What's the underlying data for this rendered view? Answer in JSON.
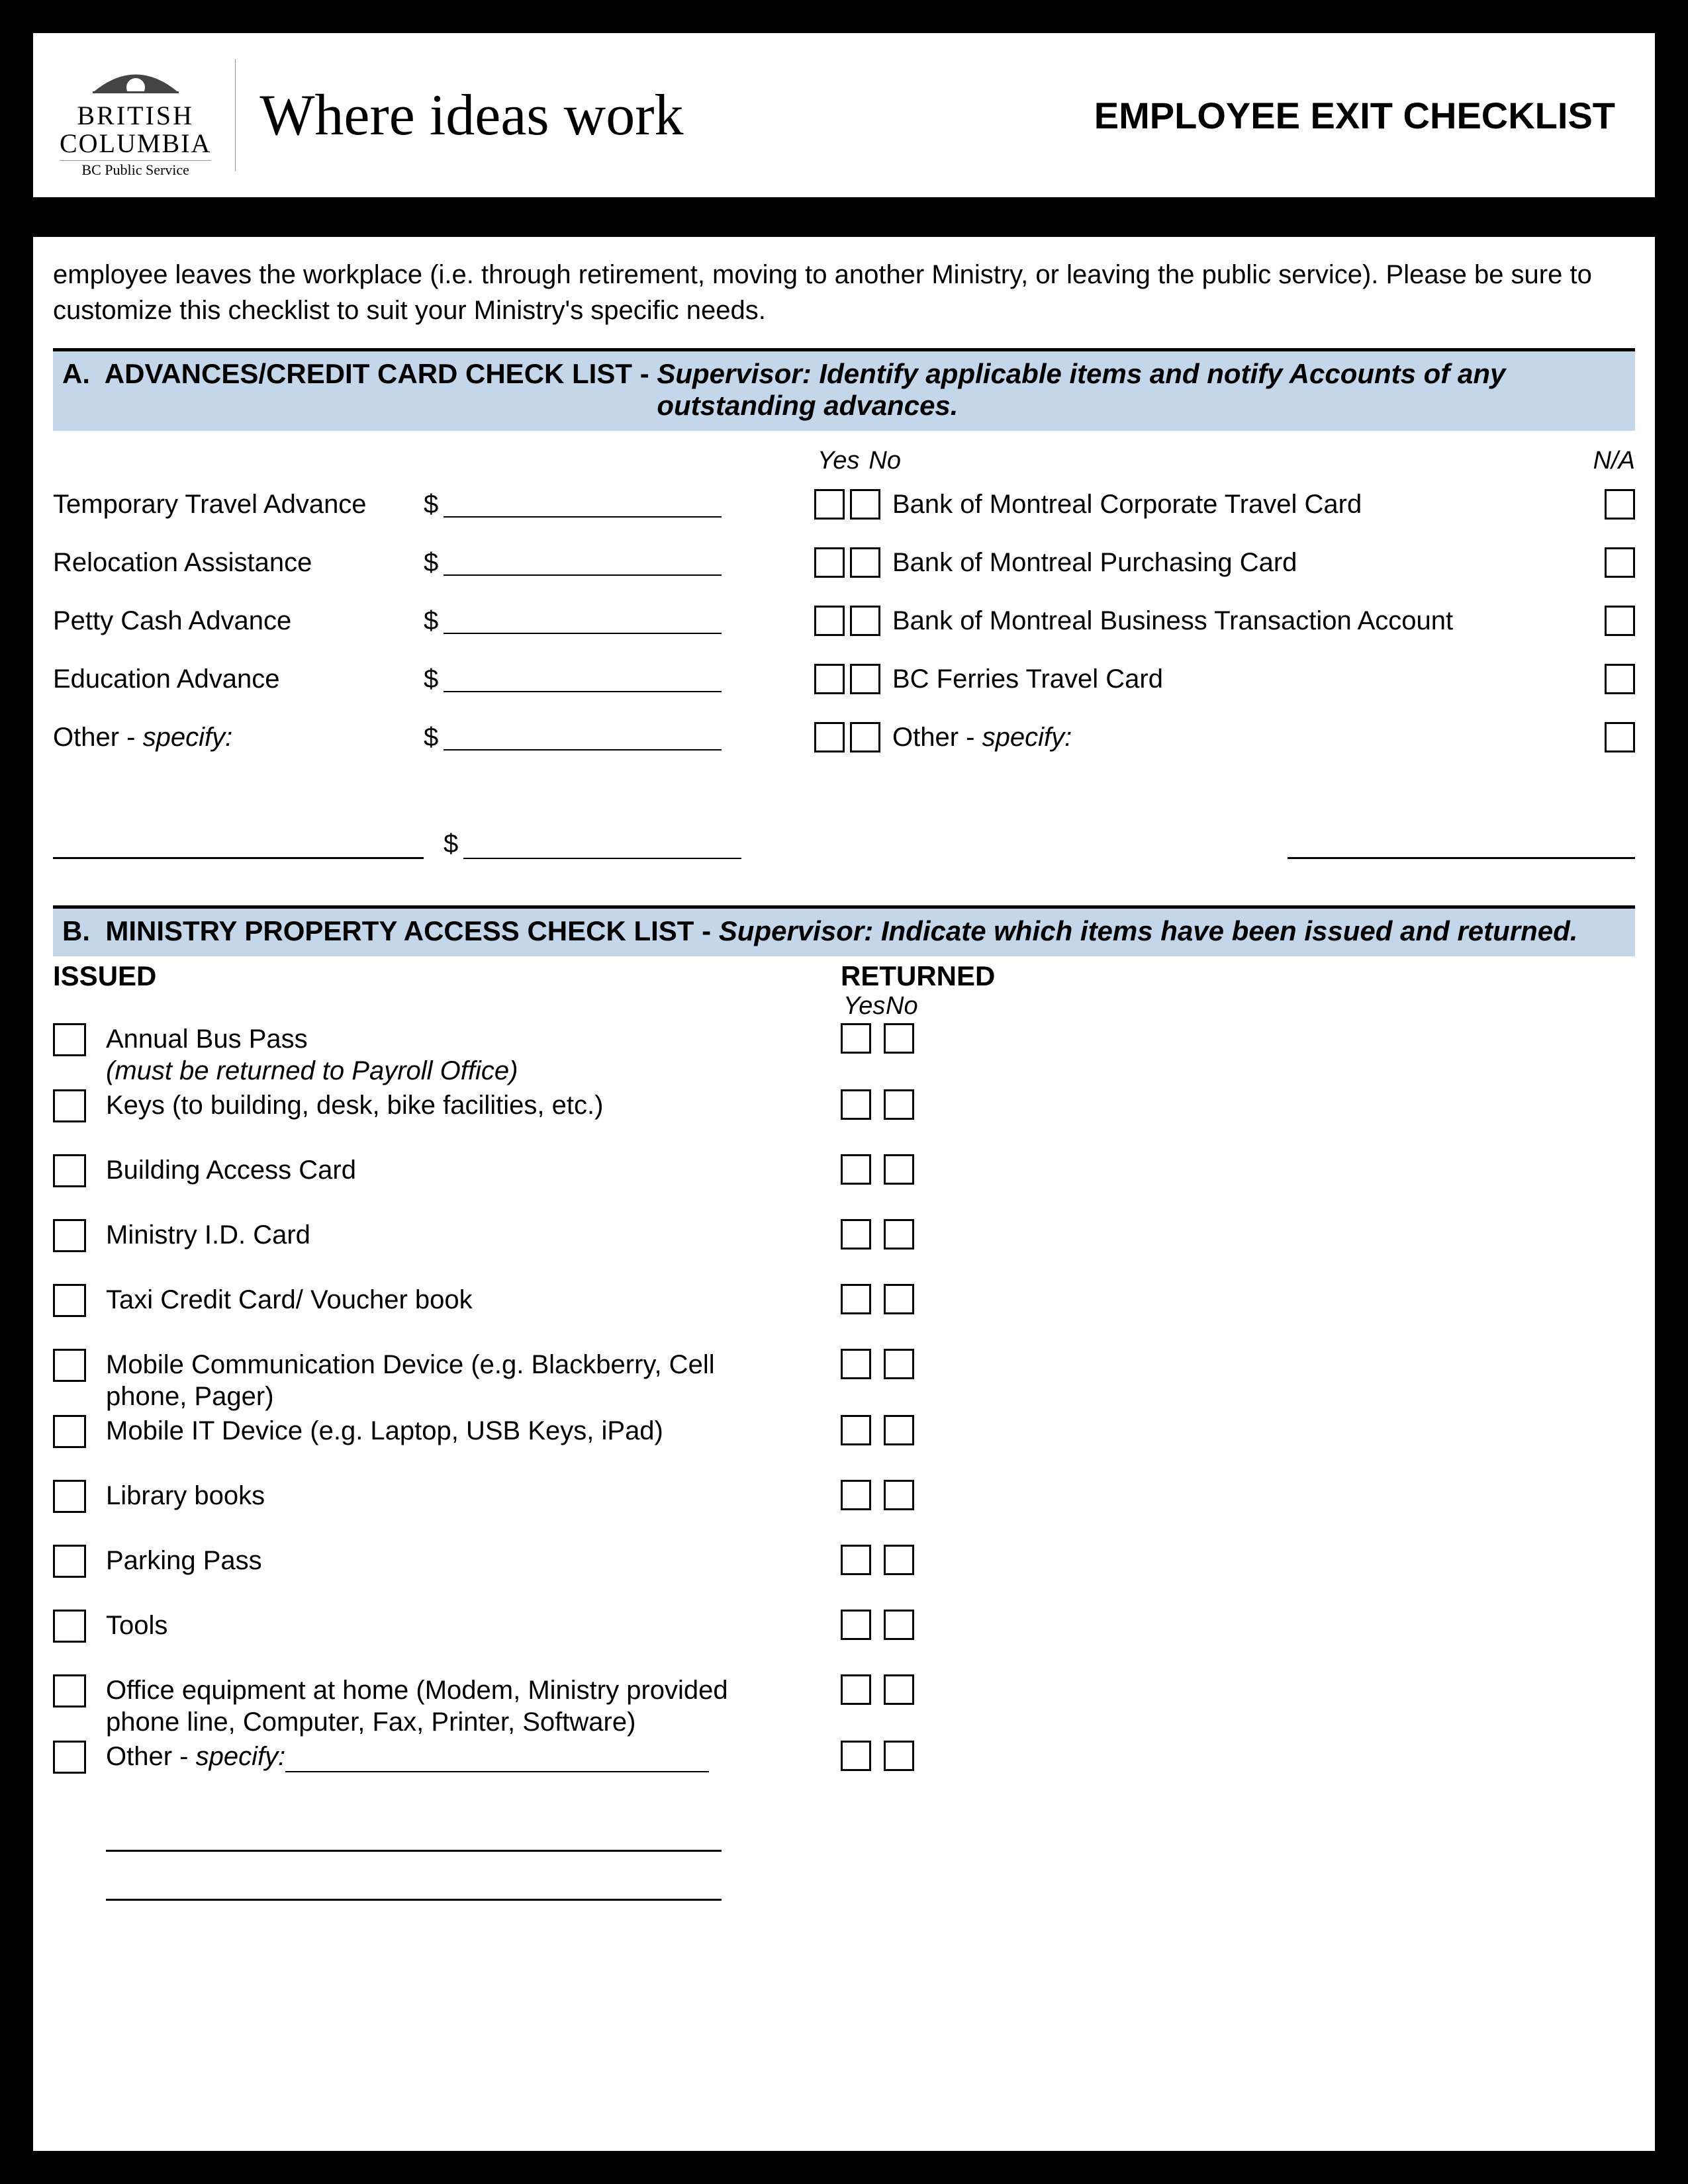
{
  "header": {
    "logo": {
      "line1": "BRITISH",
      "line2": "COLUMBIA",
      "line3": "BC Public Service"
    },
    "slogan": "Where ideas work",
    "title": "EMPLOYEE EXIT CHECKLIST"
  },
  "intro": "employee leaves the workplace (i.e. through retirement, moving to another Ministry, or leaving the public service).  Please be sure to customize this checklist to suit your Ministry's specific needs.",
  "sectionA": {
    "lead": "A.  ADVANCES/CREDIT CARD CHECK LIST - ",
    "desc": "Supervisor:  Identify applicable items and notify Accounts of any outstanding advances.",
    "yes": "Yes",
    "no": "No",
    "na": "N/A",
    "left": [
      "Temporary Travel Advance",
      "Relocation Assistance",
      "Petty Cash Advance",
      "Education Advance",
      "Other - "
    ],
    "specify": "specify:",
    "right": [
      "Bank of Montreal Corporate Travel Card",
      "Bank of Montreal Purchasing Card",
      "Bank of Montreal Business Transaction Account",
      "BC Ferries Travel Card",
      "Other - "
    ],
    "currency": "$"
  },
  "sectionB": {
    "lead": "B.  MINISTRY PROPERTY ACCESS CHECK LIST - ",
    "desc": "Supervisor:  Indicate which items have been issued and returned.",
    "issued": "ISSUED",
    "returned": "RETURNED",
    "yes": "Yes",
    "no": "No",
    "items": [
      {
        "label": "Annual Bus Pass",
        "note": "(must be returned to Payroll Office)"
      },
      {
        "label": "Keys (to building, desk, bike facilities, etc.)"
      },
      {
        "label": "Building Access Card"
      },
      {
        "label": "Ministry I.D. Card"
      },
      {
        "label": "Taxi Credit Card/ Voucher book"
      },
      {
        "label": "Mobile Communication Device (e.g. Blackberry, Cell phone, Pager)"
      },
      {
        "label": "Mobile IT Device (e.g. Laptop, USB Keys, iPad)"
      },
      {
        "label": "Library books"
      },
      {
        "label": "Parking Pass"
      },
      {
        "label": "Tools"
      },
      {
        "label": "Office equipment at home (Modem, Ministry provided phone line, Computer, Fax, Printer, Software)"
      },
      {
        "label": "Other - ",
        "specify": true
      }
    ],
    "specify": "specify:"
  }
}
